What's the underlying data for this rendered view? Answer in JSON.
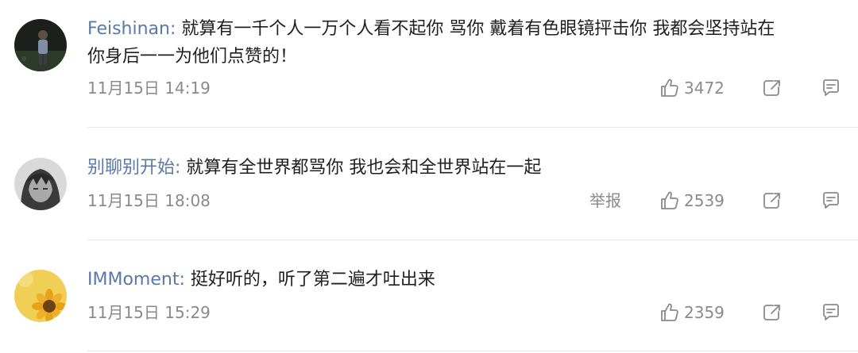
{
  "comments": [
    {
      "username": "Feishinan:",
      "text": " 就算有一千个人一万个人看不起你 骂你 戴着有色眼镜抨击你 我都会坚持站在",
      "text_continued": "你身后一一为他们点赞的！",
      "timestamp": "11月15日 14:19",
      "likes": "3472",
      "report_label": ""
    },
    {
      "username": "别聊别开始:",
      "text": " 就算有全世界都骂你 我也会和全世界站在一起",
      "timestamp": "11月15日 18:08",
      "likes": "2539",
      "report_label": "举报"
    },
    {
      "username": "IMMoment:",
      "text": " 挺好听的，听了第二遍才吐出来",
      "timestamp": "11月15日 15:29",
      "likes": "2359",
      "report_label": ""
    }
  ],
  "icons": {
    "like": "thumbs-up-icon",
    "share": "share-icon",
    "reply": "comment-icon"
  },
  "colors": {
    "username": "#5a78a8",
    "meta": "#8a8a8a",
    "divider": "#e6e6e6"
  }
}
